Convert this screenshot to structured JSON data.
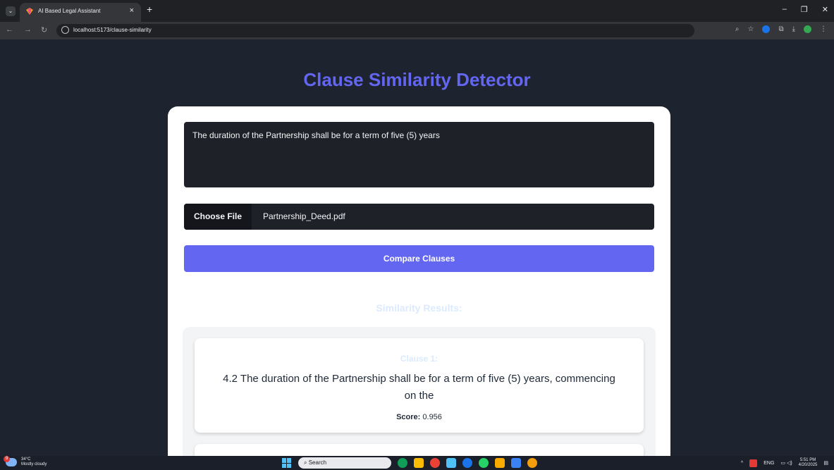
{
  "browser": {
    "tab_title": "AI Based Legal Assistant",
    "tab_close": "×",
    "new_tab": "+",
    "url": "localhost:5173/clause-similarity",
    "window_controls": [
      "–",
      "❐",
      "✕"
    ]
  },
  "page": {
    "title": "Clause Similarity Detector",
    "clause_input_value": "The duration of the Partnership shall be for a term of five (5) years",
    "file_button_label": "Choose File",
    "file_name": "Partnership_Deed.pdf",
    "compare_button_label": "Compare Clauses",
    "results_heading": "Similarity Results:",
    "results": [
      {
        "label": "Clause 1:",
        "text": "4.2 The duration of the Partnership shall be for a term of five (5) years, commencing on the",
        "score_label": "Score:",
        "score_value": "0.956"
      }
    ]
  },
  "taskbar": {
    "weather_temp": "34°C",
    "weather_desc": "Mostly cloudy",
    "weather_badge": "9",
    "search_placeholder": "Search",
    "language": "ENG",
    "time": "5:51 PM",
    "date": "4/20/2025"
  },
  "colors": {
    "accent": "#6366f1",
    "page_bg": "#1e2330",
    "input_bg": "#1f2128",
    "results_label": "#dbeafe"
  }
}
